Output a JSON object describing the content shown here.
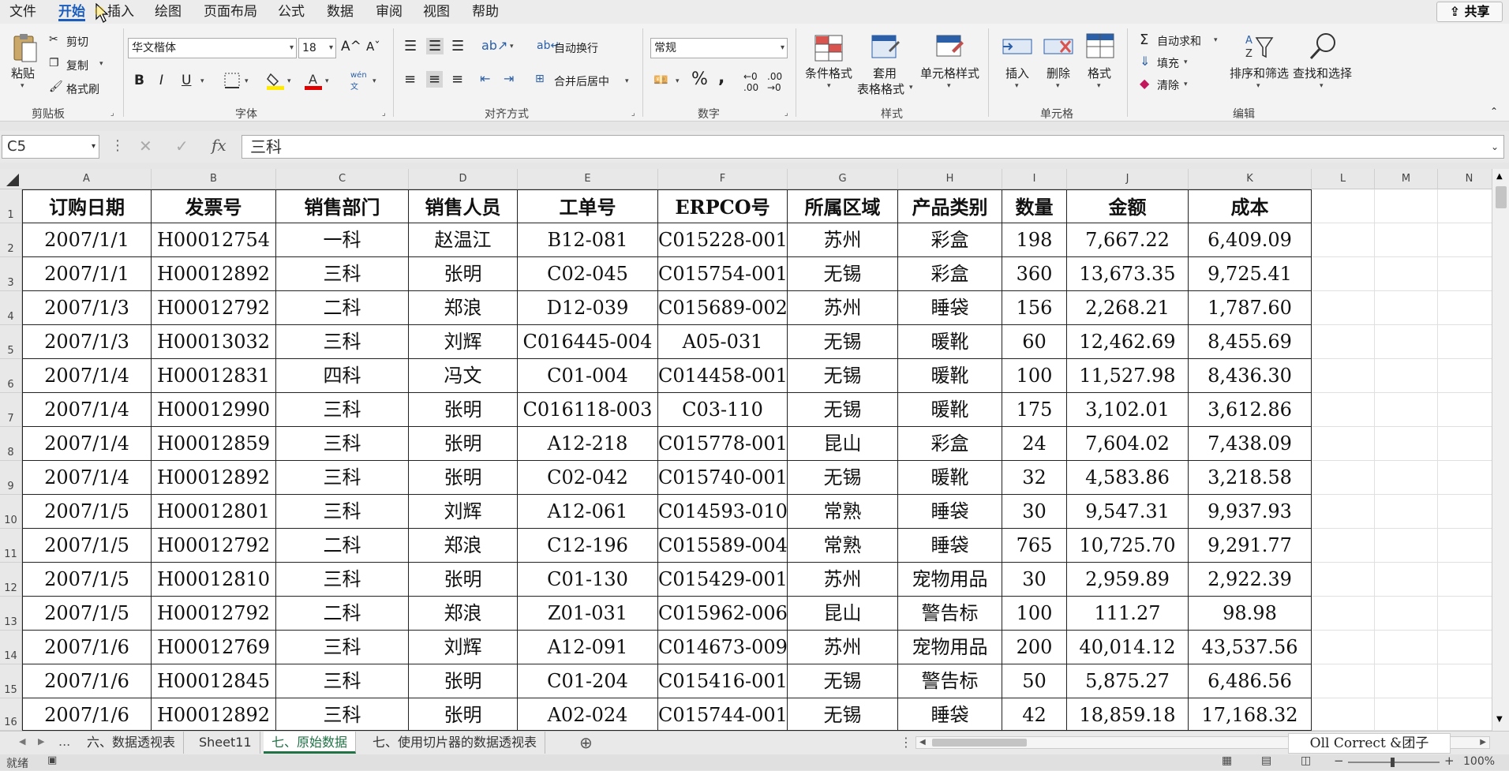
{
  "menu": {
    "file": "文件",
    "home": "开始",
    "insert": "插入",
    "draw": "绘图",
    "page_layout": "页面布局",
    "formulas": "公式",
    "data": "数据",
    "review": "审阅",
    "view": "视图",
    "help": "帮助",
    "share": "共享"
  },
  "ribbon": {
    "clipboard": {
      "label": "剪贴板",
      "paste": "粘贴",
      "cut": "剪切",
      "copy": "复制",
      "format_painter": "格式刷"
    },
    "font": {
      "label": "字体",
      "font_name": "华文楷体",
      "font_size": "18",
      "bold": "B",
      "italic": "I",
      "underline": "U"
    },
    "alignment": {
      "label": "对齐方式",
      "wrap_text": "自动换行",
      "merge_center": "合并后居中"
    },
    "number": {
      "label": "数字",
      "format": "常规",
      "percent": "%"
    },
    "styles": {
      "label": "样式",
      "conditional": "条件格式",
      "table_fmt_1": "套用",
      "table_fmt_2": "表格格式",
      "cell_style": "单元格样式"
    },
    "cells": {
      "label": "单元格",
      "insert": "插入",
      "delete": "删除",
      "format": "格式"
    },
    "editing": {
      "label": "编辑",
      "autosum": "自动求和",
      "fill": "填充",
      "clear": "清除",
      "sort_filter": "排序和筛选",
      "find_select": "查找和选择"
    }
  },
  "formula_bar": {
    "name_box": "C5",
    "fx": "fx",
    "content": "三科"
  },
  "columns": [
    "A",
    "B",
    "C",
    "D",
    "E",
    "F",
    "G",
    "H",
    "I",
    "J",
    "K",
    "L",
    "M",
    "N"
  ],
  "rows": [
    "1",
    "2",
    "3",
    "4",
    "5",
    "6",
    "7",
    "8",
    "9",
    "10",
    "11",
    "12",
    "13",
    "14",
    "15",
    "16"
  ],
  "table": {
    "headers": [
      "订购日期",
      "发票号",
      "销售部门",
      "销售人员",
      "工单号",
      "ERPCO号",
      "所属区域",
      "产品类别",
      "数量",
      "金额",
      "成本"
    ],
    "data": [
      [
        "2007/1/1",
        "H00012754",
        "一科",
        "赵温江",
        "B12-081",
        "C015228-001",
        "苏州",
        "彩盒",
        "198",
        "7,667.22",
        "6,409.09"
      ],
      [
        "2007/1/1",
        "H00012892",
        "三科",
        "张明",
        "C02-045",
        "C015754-001",
        "无锡",
        "彩盒",
        "360",
        "13,673.35",
        "9,725.41"
      ],
      [
        "2007/1/3",
        "H00012792",
        "二科",
        "郑浪",
        "D12-039",
        "C015689-002",
        "苏州",
        "睡袋",
        "156",
        "2,268.21",
        "1,787.60"
      ],
      [
        "2007/1/3",
        "H00013032",
        "三科",
        "刘辉",
        "C016445-004",
        "A05-031",
        "无锡",
        "暖靴",
        "60",
        "12,462.69",
        "8,455.69"
      ],
      [
        "2007/1/4",
        "H00012831",
        "四科",
        "冯文",
        "C01-004",
        "C014458-001",
        "无锡",
        "暖靴",
        "100",
        "11,527.98",
        "8,436.30"
      ],
      [
        "2007/1/4",
        "H00012990",
        "三科",
        "张明",
        "C016118-003",
        "C03-110",
        "无锡",
        "暖靴",
        "175",
        "3,102.01",
        "3,612.86"
      ],
      [
        "2007/1/4",
        "H00012859",
        "三科",
        "张明",
        "A12-218",
        "C015778-001",
        "昆山",
        "彩盒",
        "24",
        "7,604.02",
        "7,438.09"
      ],
      [
        "2007/1/4",
        "H00012892",
        "三科",
        "张明",
        "C02-042",
        "C015740-001",
        "无锡",
        "暖靴",
        "32",
        "4,583.86",
        "3,218.58"
      ],
      [
        "2007/1/5",
        "H00012801",
        "三科",
        "刘辉",
        "A12-061",
        "C014593-010",
        "常熟",
        "睡袋",
        "30",
        "9,547.31",
        "9,937.93"
      ],
      [
        "2007/1/5",
        "H00012792",
        "二科",
        "郑浪",
        "C12-196",
        "C015589-004",
        "常熟",
        "睡袋",
        "765",
        "10,725.70",
        "9,291.77"
      ],
      [
        "2007/1/5",
        "H00012810",
        "三科",
        "张明",
        "C01-130",
        "C015429-001",
        "苏州",
        "宠物用品",
        "30",
        "2,959.89",
        "2,922.39"
      ],
      [
        "2007/1/5",
        "H00012792",
        "二科",
        "郑浪",
        "Z01-031",
        "C015962-006",
        "昆山",
        "警告标",
        "100",
        "111.27",
        "98.98"
      ],
      [
        "2007/1/6",
        "H00012769",
        "三科",
        "刘辉",
        "A12-091",
        "C014673-009",
        "苏州",
        "宠物用品",
        "200",
        "40,014.12",
        "43,537.56"
      ],
      [
        "2007/1/6",
        "H00012845",
        "三科",
        "张明",
        "C01-204",
        "C015416-001",
        "无锡",
        "警告标",
        "50",
        "5,875.27",
        "6,486.56"
      ],
      [
        "2007/1/6",
        "H00012892",
        "三科",
        "张明",
        "A02-024",
        "C015744-001",
        "无锡",
        "睡袋",
        "42",
        "18,859.18",
        "17,168.32"
      ]
    ]
  },
  "sheet_tabs": [
    "六、数据透视表",
    "Sheet11",
    "七、原始数据",
    "七、使用切片器的数据透视表"
  ],
  "active_tab_index": 2,
  "tab_ellipsis": "...",
  "status": {
    "ready": "就绪",
    "zoom": "100%"
  },
  "watermark": "Oll Correct &团子"
}
